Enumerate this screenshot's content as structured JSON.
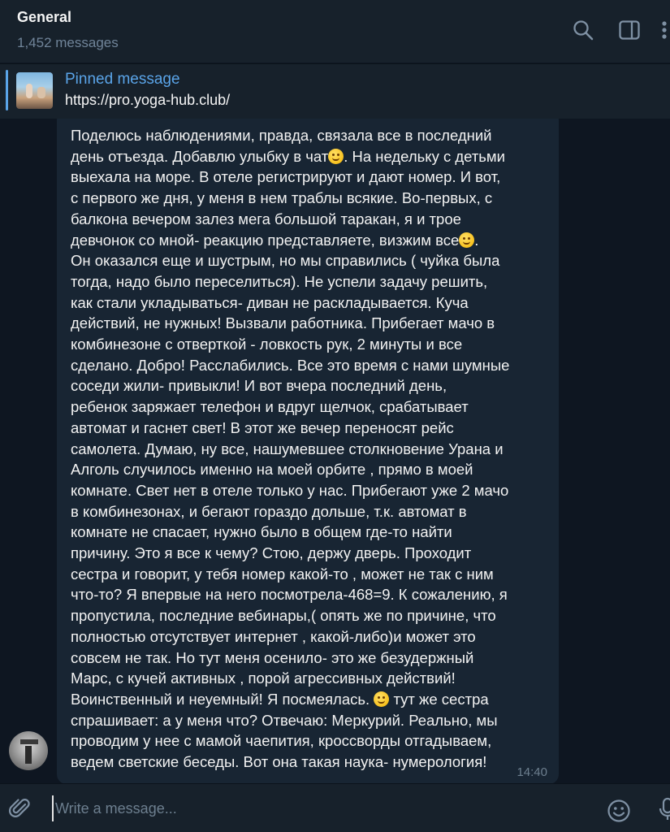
{
  "header": {
    "title": "General",
    "subtitle": "1,452 messages",
    "icons": [
      "search-icon",
      "sidebar-toggle-icon",
      "more-icon"
    ]
  },
  "pinned": {
    "title": "Pinned message",
    "text": "https://pro.yoga-hub.club/"
  },
  "message": {
    "lines": [
      "Поделюсь наблюдениями, правда, связала все в последний",
      "день отъезда. Добавлю улыбку в чат",
      ". На недельку с детьми",
      "выехала на море. В отеле регистрируют и дают номер. И вот,",
      "с первого же дня, у меня в нем траблы всякие. Во-первых, с",
      "балкона вечером залез мега большой таракан, я и трое",
      "девчонок со мной- реакцию представляете, визжим все",
      ".",
      "Он оказался еще и шустрым, но мы справились ( чуйка была",
      "тогда, надо было переселиться). Не успели задачу решить,",
      "как стали укладываться- диван не раскладывается. Куча",
      "действий, не нужных! Вызвали работника. Прибегает мачо в",
      "комбинезоне с отверткой - ловкость рук, 2 минуты и все",
      "сделано. Добро! Расслабились. Все это время с нами шумные",
      "соседи жили- привыкли! И вот вчера последний день,",
      "ребенок заряжает телефон и вдруг щелчок, срабатывает",
      "автомат и гаснет свет! В этот же вечер переносят рейс",
      "самолета. Думаю, ну все, нашумевшее столкновение Урана и",
      "Алголь случилось именно на моей орбите , прямо в моей",
      "комнате. Свет нет в отеле только у нас. Прибегают уже 2 мачо",
      "в комбинезонах, и бегают гораздо дольше, т.к. автомат в",
      "комнате не спасает, нужно было в общем где-то найти",
      "причину. Это я все к чему? Стою, держу дверь. Проходит",
      "сестра и говорит, у тебя номер какой-то , может не так с ним",
      "что-то? Я впервые на него посмотрела-468=9. К сожалению, я",
      "пропустила, последние вебинары,( опять же по причине, что",
      "полностью отсутствует интернет , какой-либо)и может это",
      "совсем не так. Но тут меня осенило- это же безудержный",
      "Марс, с кучей активных , порой агрессивных действий!",
      "Воинственный и неуемный! Я посмеялась.",
      "тут же сестра",
      "спрашивает: а у меня что? Отвечаю: Меркурий. Реально, мы",
      "проводим у нее с мамой чаепития, кроссворды отгадываем,",
      "ведем светские беседы. Вот она такая наука- нумерология!"
    ],
    "emojis": [
      "smile-emoji",
      "laughing-tears-emoji",
      "hand-over-mouth-emoji"
    ],
    "time": "14:40"
  },
  "composer": {
    "placeholder": "Write a message..."
  },
  "colors": {
    "background": "#0e1621",
    "header": "#17212b",
    "bubble": "#182533",
    "accent": "#5aa4e8",
    "muted": "#708499"
  }
}
